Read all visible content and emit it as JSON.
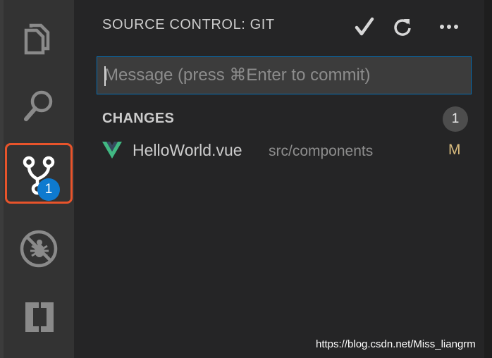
{
  "activity_bar": {
    "items": [
      {
        "icon": "files-icon",
        "label": "Explorer"
      },
      {
        "icon": "search-icon",
        "label": "Search"
      },
      {
        "icon": "source-control-icon",
        "label": "Source Control",
        "badge": "1",
        "active": true
      },
      {
        "icon": "debug-icon",
        "label": "Debug"
      },
      {
        "icon": "extensions-icon",
        "label": "Extensions"
      }
    ],
    "highlight_color": "#e8542b",
    "badge_color": "#0e7acf"
  },
  "sidebar": {
    "title": "SOURCE CONTROL: GIT",
    "actions": [
      {
        "icon": "checkmark-icon",
        "label": "Commit"
      },
      {
        "icon": "refresh-icon",
        "label": "Refresh"
      },
      {
        "icon": "more-icon",
        "label": "More Actions"
      }
    ],
    "commit_message": {
      "value": "",
      "placeholder": "Message (press ⌘Enter to commit)"
    },
    "changes": {
      "label": "CHANGES",
      "count": "1",
      "files": [
        {
          "icon": "vue-icon",
          "name": "HelloWorld.vue",
          "path": "src/components",
          "status": "M",
          "status_color": "#d7ba7d"
        }
      ]
    }
  },
  "watermark": "https://blog.csdn.net/Miss_liangrm"
}
